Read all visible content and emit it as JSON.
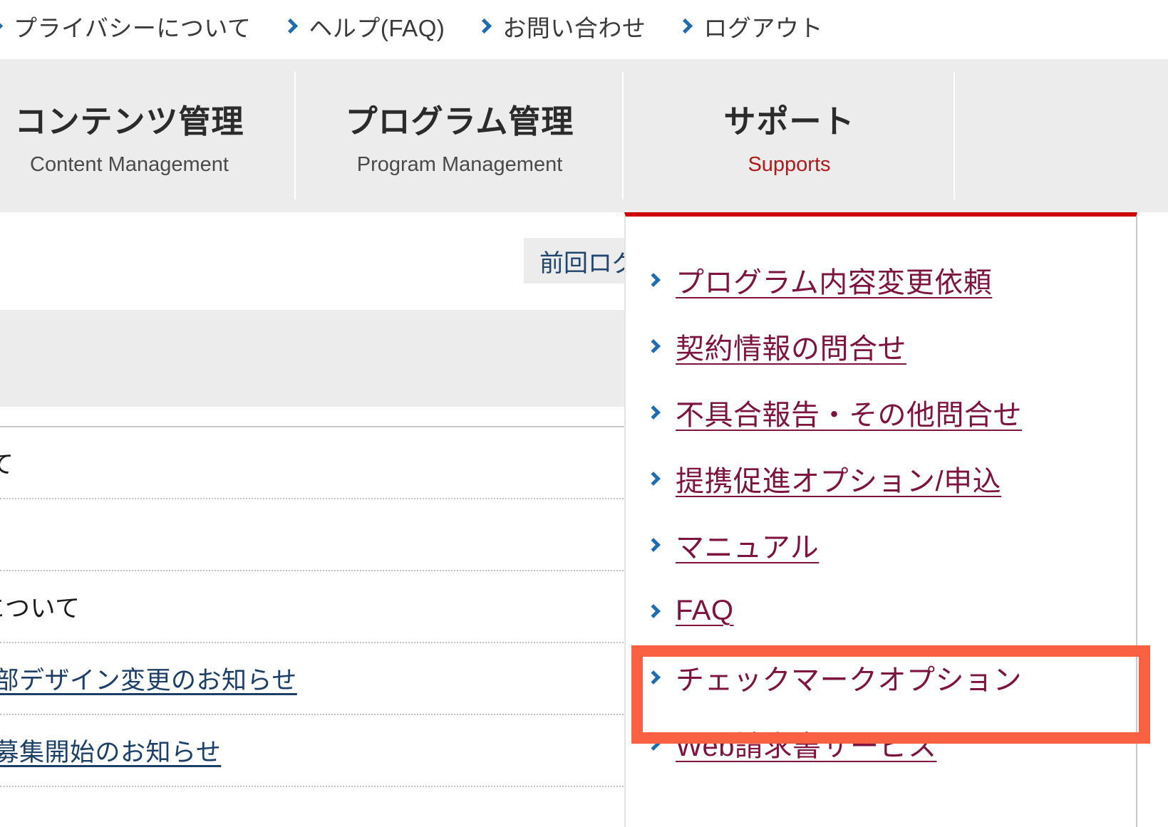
{
  "utility_nav": {
    "items": [
      {
        "label": "プライバシーについて",
        "icon": "chevron-right-icon"
      },
      {
        "label": "ヘルプ(FAQ)",
        "icon": "chevron-right-icon"
      },
      {
        "label": "お問い合わせ",
        "icon": "chevron-right-icon"
      },
      {
        "label": "ログアウト",
        "icon": "chevron-right-icon"
      }
    ]
  },
  "main_tabs": [
    {
      "ja": "コンテンツ管理",
      "en": "Content Management",
      "active": false
    },
    {
      "ja": "プログラム管理",
      "en": "Program Management",
      "active": false
    },
    {
      "ja": "サポート",
      "en": "Supports",
      "active": true
    }
  ],
  "content": {
    "last_login_label": "前回ログ",
    "news_items": [
      {
        "text": "の提供について",
        "is_link": false
      },
      {
        "text": "",
        "is_link": false
      },
      {
        "text": "の仕様変更について",
        "is_link": false
      },
      {
        "text": "管理画面一部デザイン変更のお知らせ",
        "is_link": true
      },
      {
        "text": "掲載広告主募集開始のお知らせ",
        "is_link": true
      }
    ]
  },
  "support_dropdown": {
    "top_border_color": "#cc0000",
    "items": [
      {
        "label": "プログラム内容変更依頼",
        "icon": "chevron-right-icon",
        "highlighted": false,
        "underlined": true
      },
      {
        "label": "契約情報の問合せ",
        "icon": "chevron-right-icon",
        "highlighted": false,
        "underlined": true
      },
      {
        "label": "不具合報告・その他問合せ",
        "icon": "chevron-right-icon",
        "highlighted": false,
        "underlined": true
      },
      {
        "label": "提携促進オプション/申込",
        "icon": "chevron-right-icon",
        "highlighted": false,
        "underlined": true
      },
      {
        "label": "マニュアル",
        "icon": "chevron-right-icon",
        "highlighted": false,
        "underlined": true
      },
      {
        "label": "FAQ",
        "icon": "chevron-right-icon",
        "highlighted": false,
        "underlined": true
      },
      {
        "label": "チェックマークオプション",
        "icon": "chevron-right-icon",
        "highlighted": true,
        "underlined": false
      },
      {
        "label": "Web請求書サービス",
        "icon": "chevron-right-icon",
        "highlighted": false,
        "underlined": true
      }
    ]
  },
  "annotation": {
    "highlight_color": "#fa6142",
    "target_label": "チェックマークオプション"
  },
  "colors": {
    "chevron_blue": "#1f6cb0",
    "link_maroon": "#7d1440",
    "accent_red": "#cc0000",
    "tab_bar_bg": "#ececec",
    "support_en_red": "#b01a1a",
    "news_link_blue": "#1c3f68"
  }
}
